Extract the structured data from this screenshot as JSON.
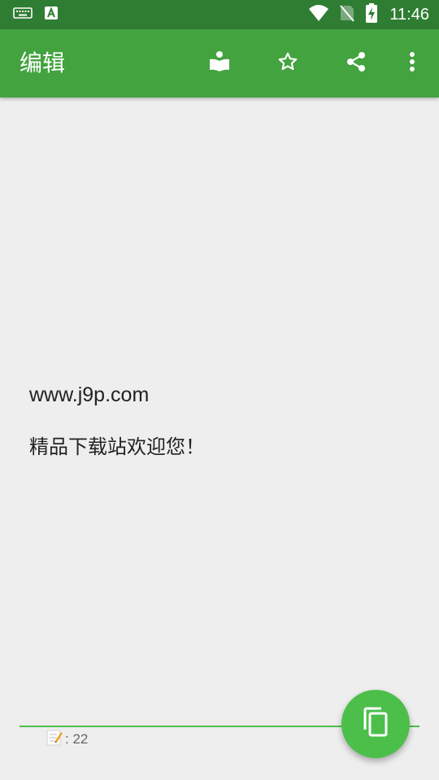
{
  "status_bar": {
    "time": "11:46",
    "icons": [
      "keyboard-icon",
      "app-a-icon",
      "wifi-icon",
      "no-sim-icon",
      "battery-charging-icon"
    ]
  },
  "toolbar": {
    "title": "编辑",
    "actions": [
      "read-mode-icon",
      "star-icon",
      "share-icon",
      "more-vert-icon"
    ]
  },
  "editor": {
    "line1": "www.j9p.com",
    "line2": "精品下载站欢迎您！"
  },
  "footer": {
    "count_label": ": 22",
    "count_icon": "memo-icon"
  },
  "fab": {
    "icon": "copy-icon"
  },
  "colors": {
    "status_bar": "#2f7d32",
    "toolbar": "#43a33f",
    "background": "#eeeeee",
    "accent": "#4cbf4a"
  }
}
